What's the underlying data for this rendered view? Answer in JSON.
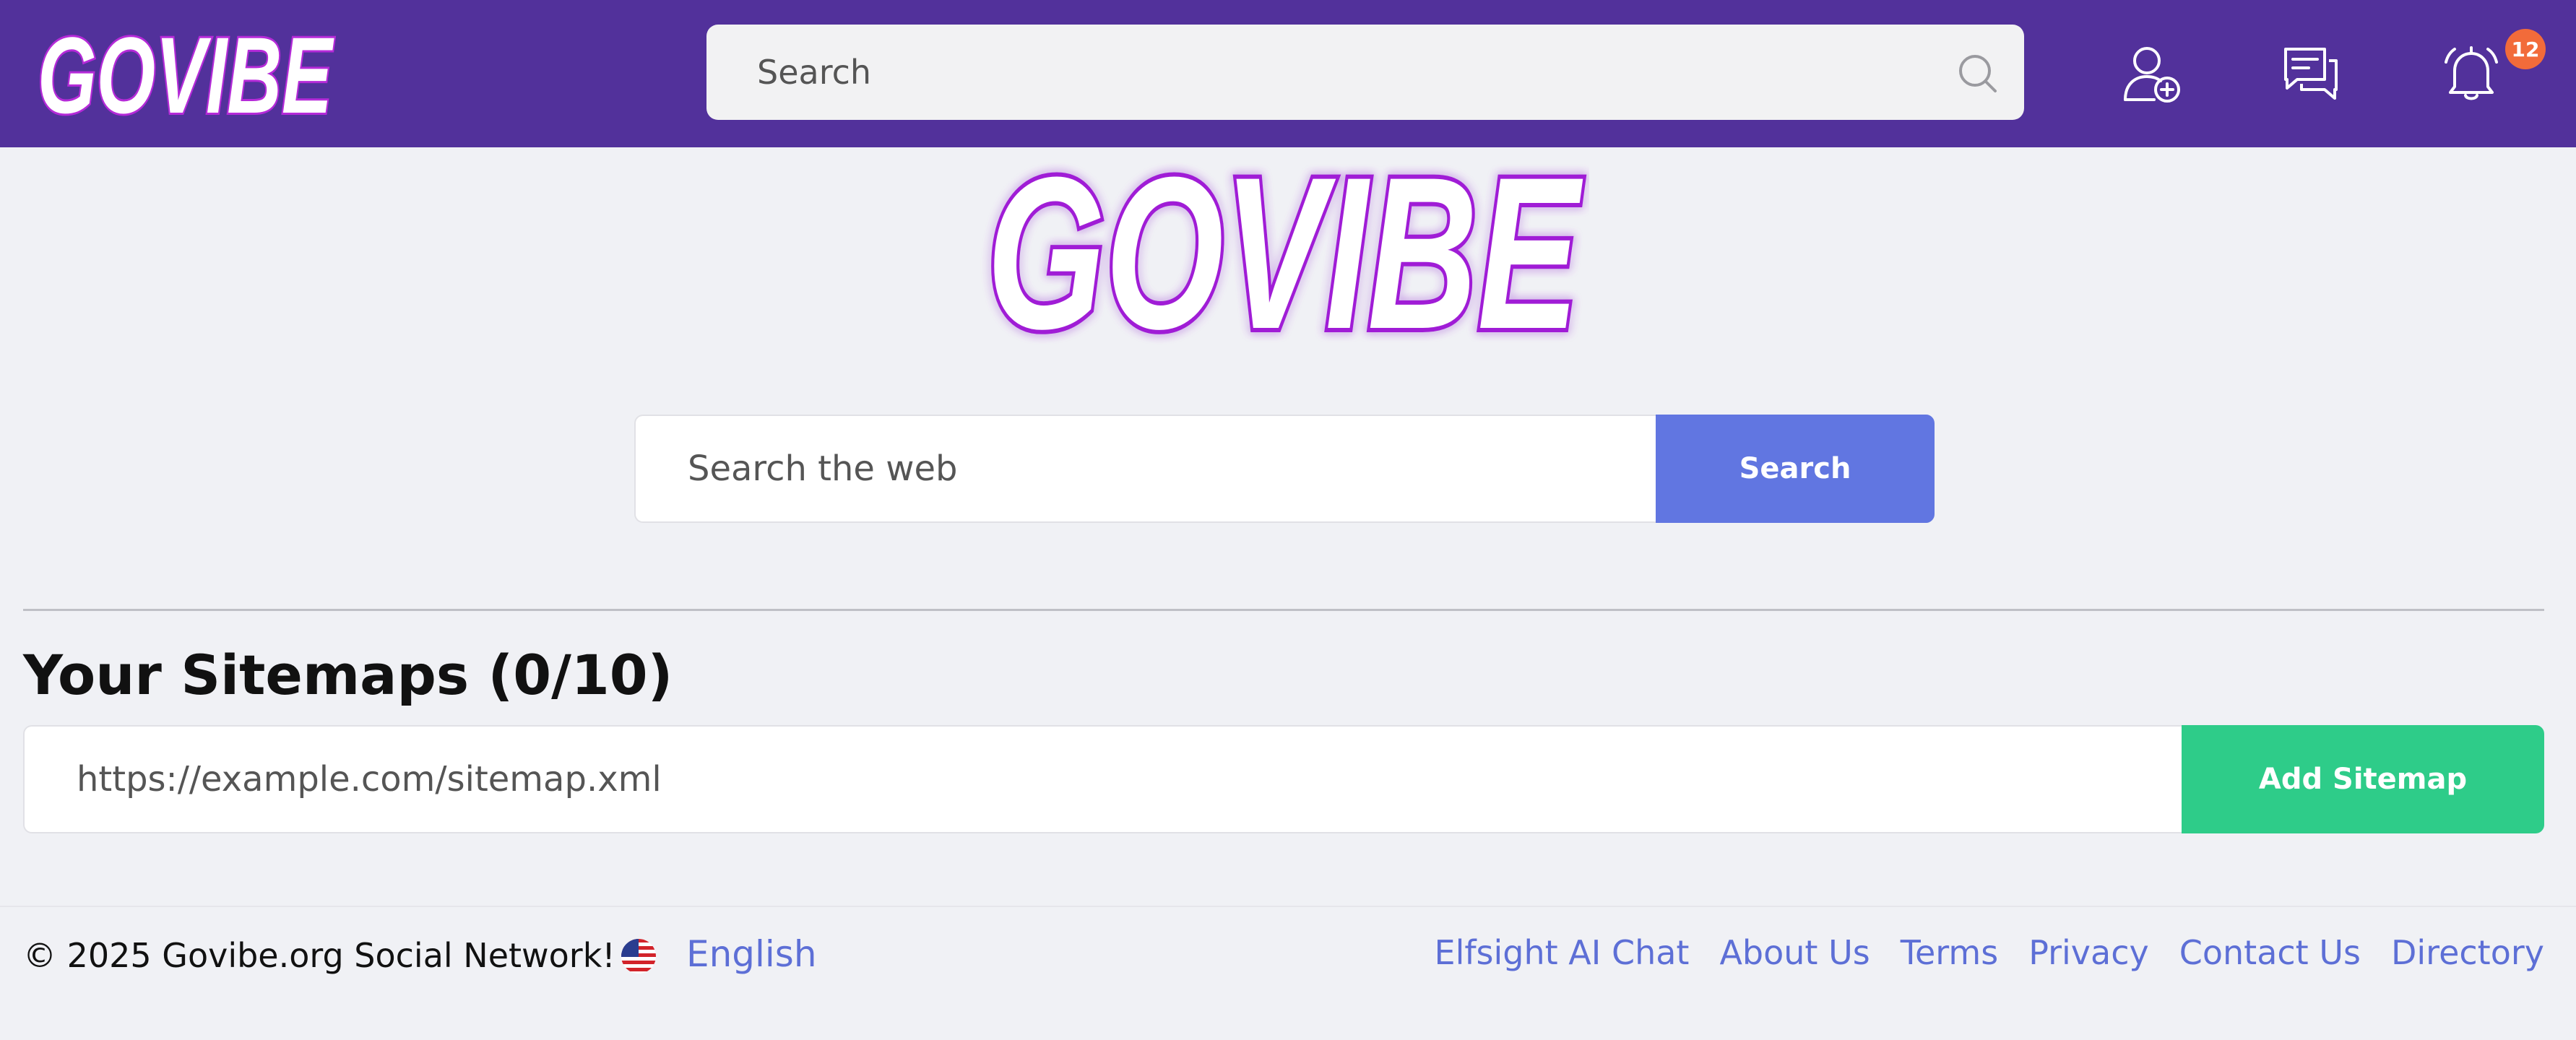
{
  "header": {
    "logo_text": "GOVIBE",
    "search_placeholder": "Search",
    "notification_count": "12",
    "icons": [
      "add-user-icon",
      "messages-icon",
      "bell-icon",
      "search-icon"
    ]
  },
  "main": {
    "logo_text": "GOVIBE",
    "web_search": {
      "placeholder": "Search the web",
      "button_label": "Search"
    },
    "sitemaps": {
      "title": "Your Sitemaps (0/10)",
      "input_placeholder": "https://example.com/sitemap.xml",
      "button_label": "Add Sitemap"
    }
  },
  "footer": {
    "copyright": "© 2025 Govibe.org Social Network!",
    "language": "English",
    "links": [
      "Elfsight AI Chat",
      "About Us",
      "Terms",
      "Privacy",
      "Contact Us",
      "Directory"
    ]
  },
  "colors": {
    "header_bg": "#52319b",
    "search_button": "#6176e1",
    "add_sitemap_button": "#2ecc89",
    "link": "#5d6fd6",
    "badge": "#f26b3a",
    "logo_glow": "#c21fe0"
  }
}
